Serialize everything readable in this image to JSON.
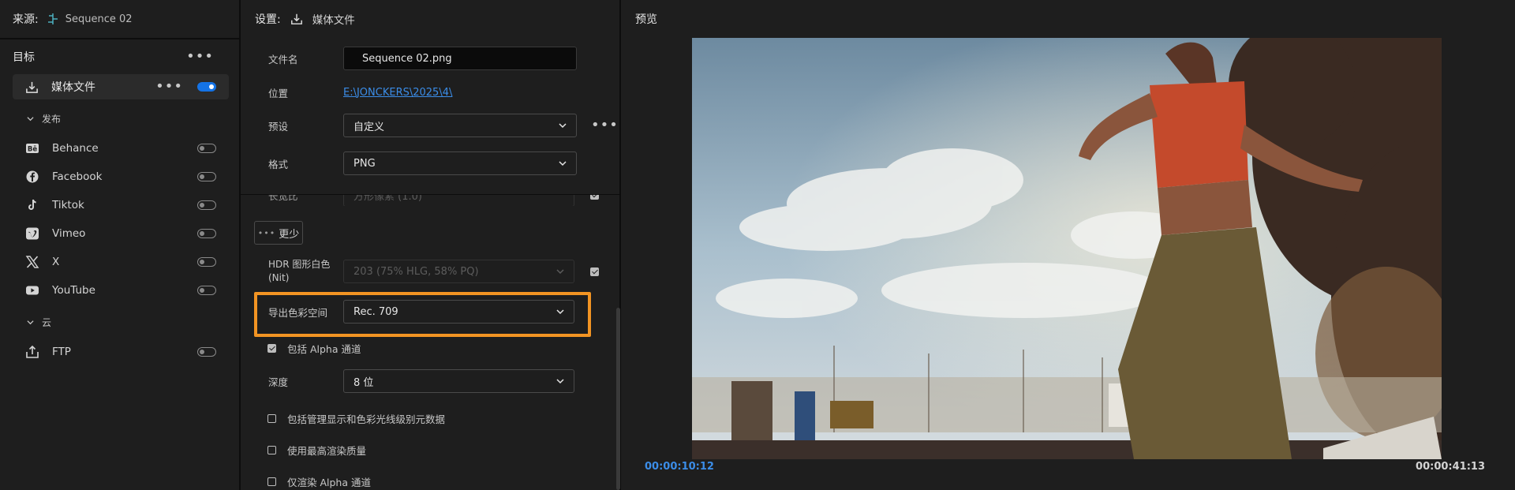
{
  "source": {
    "label": "来源:",
    "sequence": "Sequence 02"
  },
  "targets": {
    "title": "目标",
    "media": {
      "label": "媒体文件",
      "enabled": true
    },
    "publish_section": "发布",
    "publish_items": [
      {
        "name": "Behance",
        "icon": "behance-icon",
        "enabled": false
      },
      {
        "name": "Facebook",
        "icon": "facebook-icon",
        "enabled": false
      },
      {
        "name": "Tiktok",
        "icon": "tiktok-icon",
        "enabled": false
      },
      {
        "name": "Vimeo",
        "icon": "vimeo-icon",
        "enabled": false
      },
      {
        "name": "X",
        "icon": "x-icon",
        "enabled": false
      },
      {
        "name": "YouTube",
        "icon": "youtube-icon",
        "enabled": false
      }
    ],
    "cloud_section": "云",
    "cloud_items": [
      {
        "name": "FTP",
        "icon": "ftp-upload-icon",
        "enabled": false
      }
    ]
  },
  "settings": {
    "label": "设置:",
    "target_name": "媒体文件",
    "filename_label": "文件名",
    "filename_value": "Sequence 02.png",
    "location_label": "位置",
    "location_value": "E:\\JONCKERS\\2025\\4\\",
    "preset_label": "预设",
    "preset_value": "自定义",
    "format_label": "格式",
    "format_value": "PNG",
    "clipped_label": "长宽比",
    "clipped_value": "方形像素 (1.0)",
    "less_button": "更少",
    "hdr_label_line1": "HDR 图形白色",
    "hdr_label_line2": "(Nit)",
    "hdr_value": "203 (75% HLG, 58% PQ)",
    "hdr_checked": true,
    "color_space_label": "导出色彩空间",
    "color_space_value": "Rec. 709",
    "include_alpha": {
      "label": "包括 Alpha 通道",
      "checked": true
    },
    "depth_label": "深度",
    "depth_value": "8 位",
    "include_metadata": {
      "label": "包括管理显示和色彩光线级别元数据",
      "checked": false
    },
    "max_quality": {
      "label": "使用最高渲染质量",
      "checked": false
    },
    "alpha_only": {
      "label": "仅渲染 Alpha 通道",
      "checked": false
    }
  },
  "preview": {
    "title": "预览",
    "timecode_current": "00:00:10:12",
    "timecode_total": "00:00:41:13"
  },
  "colors": {
    "accent": "#1473e6",
    "highlight": "#f29423",
    "link": "#3b8de8"
  }
}
